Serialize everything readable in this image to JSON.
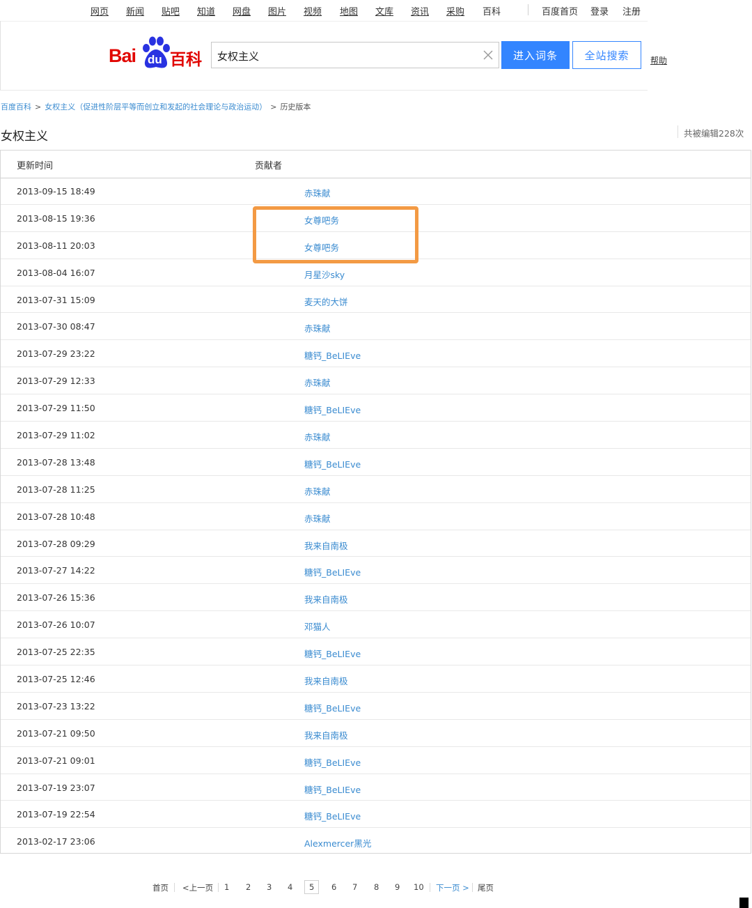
{
  "topnav": {
    "items": [
      "网页",
      "新闻",
      "贴吧",
      "知道",
      "网盘",
      "图片",
      "视频",
      "地图",
      "文库",
      "资讯",
      "采购",
      "百科"
    ],
    "right_items": [
      "百度首页",
      "登录",
      "注册"
    ]
  },
  "logo": {
    "bai": "Bai",
    "du": "du",
    "baike": "百科"
  },
  "search": {
    "value": "女权主义",
    "enter_label": "进入词条",
    "site_search_label": "全站搜索",
    "help_label": "帮助"
  },
  "breadcrumb": {
    "root": "百度百科",
    "entry": "女权主义（促进性阶层平等而创立和发起的社会理论与政治运动）",
    "current": "历史版本"
  },
  "page": {
    "title": "女权主义",
    "edit_count": "共被编辑228次"
  },
  "table": {
    "headers": {
      "time": "更新时间",
      "contributor": "贡献者"
    },
    "rows": [
      {
        "time": "2013-09-15 18:49",
        "editor": "赤珠献"
      },
      {
        "time": "2013-08-15 19:36",
        "editor": "女尊吧务"
      },
      {
        "time": "2013-08-11 20:03",
        "editor": "女尊吧务"
      },
      {
        "time": "2013-08-04 16:07",
        "editor": "月星沙sky"
      },
      {
        "time": "2013-07-31 15:09",
        "editor": "麦天的大饼"
      },
      {
        "time": "2013-07-30 08:47",
        "editor": "赤珠献"
      },
      {
        "time": "2013-07-29 23:22",
        "editor": "糖钙_BeLIEve"
      },
      {
        "time": "2013-07-29 12:33",
        "editor": "赤珠献"
      },
      {
        "time": "2013-07-29 11:50",
        "editor": "糖钙_BeLIEve"
      },
      {
        "time": "2013-07-29 11:02",
        "editor": "赤珠献"
      },
      {
        "time": "2013-07-28 13:48",
        "editor": "糖钙_BeLIEve"
      },
      {
        "time": "2013-07-28 11:25",
        "editor": "赤珠献"
      },
      {
        "time": "2013-07-28 10:48",
        "editor": "赤珠献"
      },
      {
        "time": "2013-07-28 09:29",
        "editor": "我来自南极"
      },
      {
        "time": "2013-07-27 14:22",
        "editor": "糖钙_BeLIEve"
      },
      {
        "time": "2013-07-26 15:36",
        "editor": "我来自南极"
      },
      {
        "time": "2013-07-26 10:07",
        "editor": "邓猫人"
      },
      {
        "time": "2013-07-25 22:35",
        "editor": "糖钙_BeLIEve"
      },
      {
        "time": "2013-07-25 12:46",
        "editor": "我来自南极"
      },
      {
        "time": "2013-07-23 13:22",
        "editor": "糖钙_BeLIEve"
      },
      {
        "time": "2013-07-21 09:50",
        "editor": "我来自南极"
      },
      {
        "time": "2013-07-21 09:01",
        "editor": "糖钙_BeLIEve"
      },
      {
        "time": "2013-07-19 23:07",
        "editor": "糖钙_BeLIEve"
      },
      {
        "time": "2013-07-19 22:54",
        "editor": "糖钙_BeLIEve"
      },
      {
        "time": "2013-02-17 23:06",
        "editor": "Alexmercer黑光"
      }
    ]
  },
  "pagination": {
    "first": "首页",
    "prev": "<上一页",
    "pages": [
      "1",
      "2",
      "3",
      "4",
      "5",
      "6",
      "7",
      "8",
      "9",
      "10"
    ],
    "current": "5",
    "next": "下一页 >",
    "last": "尾页"
  },
  "colors": {
    "link": "#3a8bd0",
    "button": "#3385ff",
    "logo_red": "#e10602",
    "highlight": "#f39a44"
  }
}
